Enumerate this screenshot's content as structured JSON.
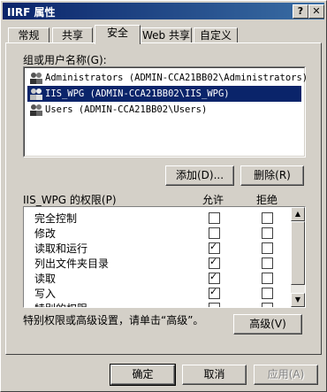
{
  "window": {
    "title": "IIRF 属性",
    "help_label": "?",
    "close_label": "✕"
  },
  "tabs": [
    {
      "label": "常规"
    },
    {
      "label": "共享"
    },
    {
      "label": "安全"
    },
    {
      "label": "Web 共享"
    },
    {
      "label": "自定义"
    }
  ],
  "groups_label": "组或用户名称(G):",
  "users": [
    {
      "label": "Administrators (ADMIN-CCA21BB02\\Administrators)"
    },
    {
      "label": "IIS_WPG (ADMIN-CCA21BB02\\IIS_WPG)"
    },
    {
      "label": "Users (ADMIN-CCA21BB02\\Users)"
    }
  ],
  "buttons": {
    "add": "添加(D)...",
    "remove": "删除(R)",
    "advanced": "高级(V)",
    "ok": "确定",
    "cancel": "取消",
    "apply": "应用(A)"
  },
  "permissions": {
    "header": "IIS_WPG 的权限(P)",
    "allow_header": "允许",
    "deny_header": "拒绝",
    "rows": [
      {
        "label": "完全控制",
        "allow": false,
        "deny": false
      },
      {
        "label": "修改",
        "allow": false,
        "deny": false
      },
      {
        "label": "读取和运行",
        "allow": true,
        "deny": false
      },
      {
        "label": "列出文件夹目录",
        "allow": true,
        "deny": false
      },
      {
        "label": "读取",
        "allow": true,
        "deny": false
      },
      {
        "label": "写入",
        "allow": true,
        "deny": false
      },
      {
        "label": "特别的权限",
        "allow": false,
        "deny": false
      }
    ]
  },
  "advanced_note": "特别权限或高级设置，请单击“高级”。"
}
